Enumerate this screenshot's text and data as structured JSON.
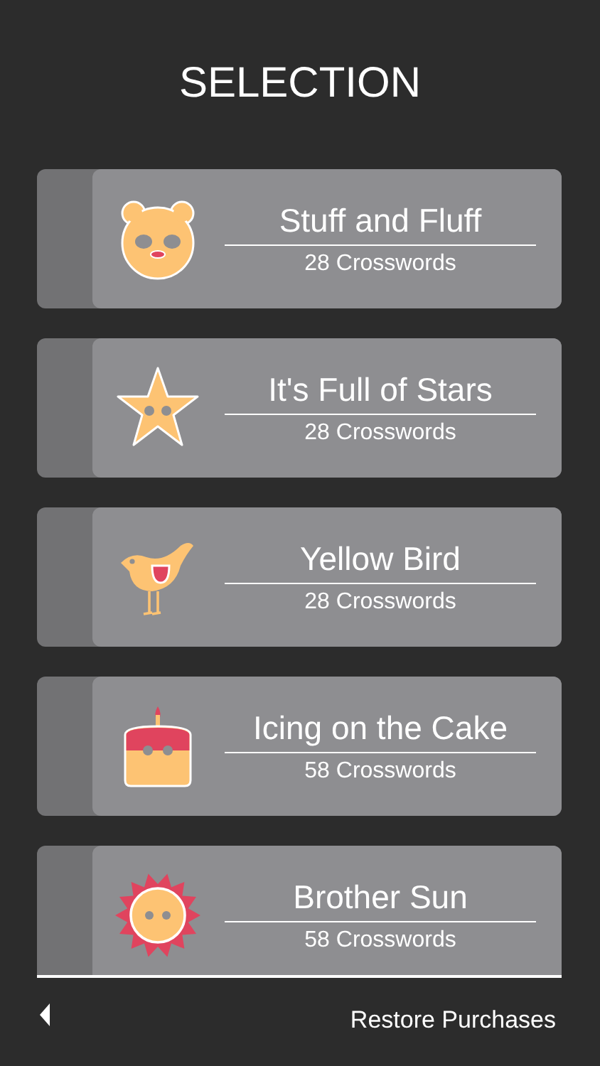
{
  "title": "SELECTION",
  "packs": [
    {
      "name": "Stuff and Fluff",
      "count": "28 Crosswords"
    },
    {
      "name": "It's Full of Stars",
      "count": "28 Crosswords"
    },
    {
      "name": "Yellow Bird",
      "count": "28 Crosswords"
    },
    {
      "name": "Icing on the Cake",
      "count": "58 Crosswords"
    },
    {
      "name": "Brother Sun",
      "count": "58 Crosswords"
    }
  ],
  "footer": {
    "restore": "Restore Purchases"
  }
}
